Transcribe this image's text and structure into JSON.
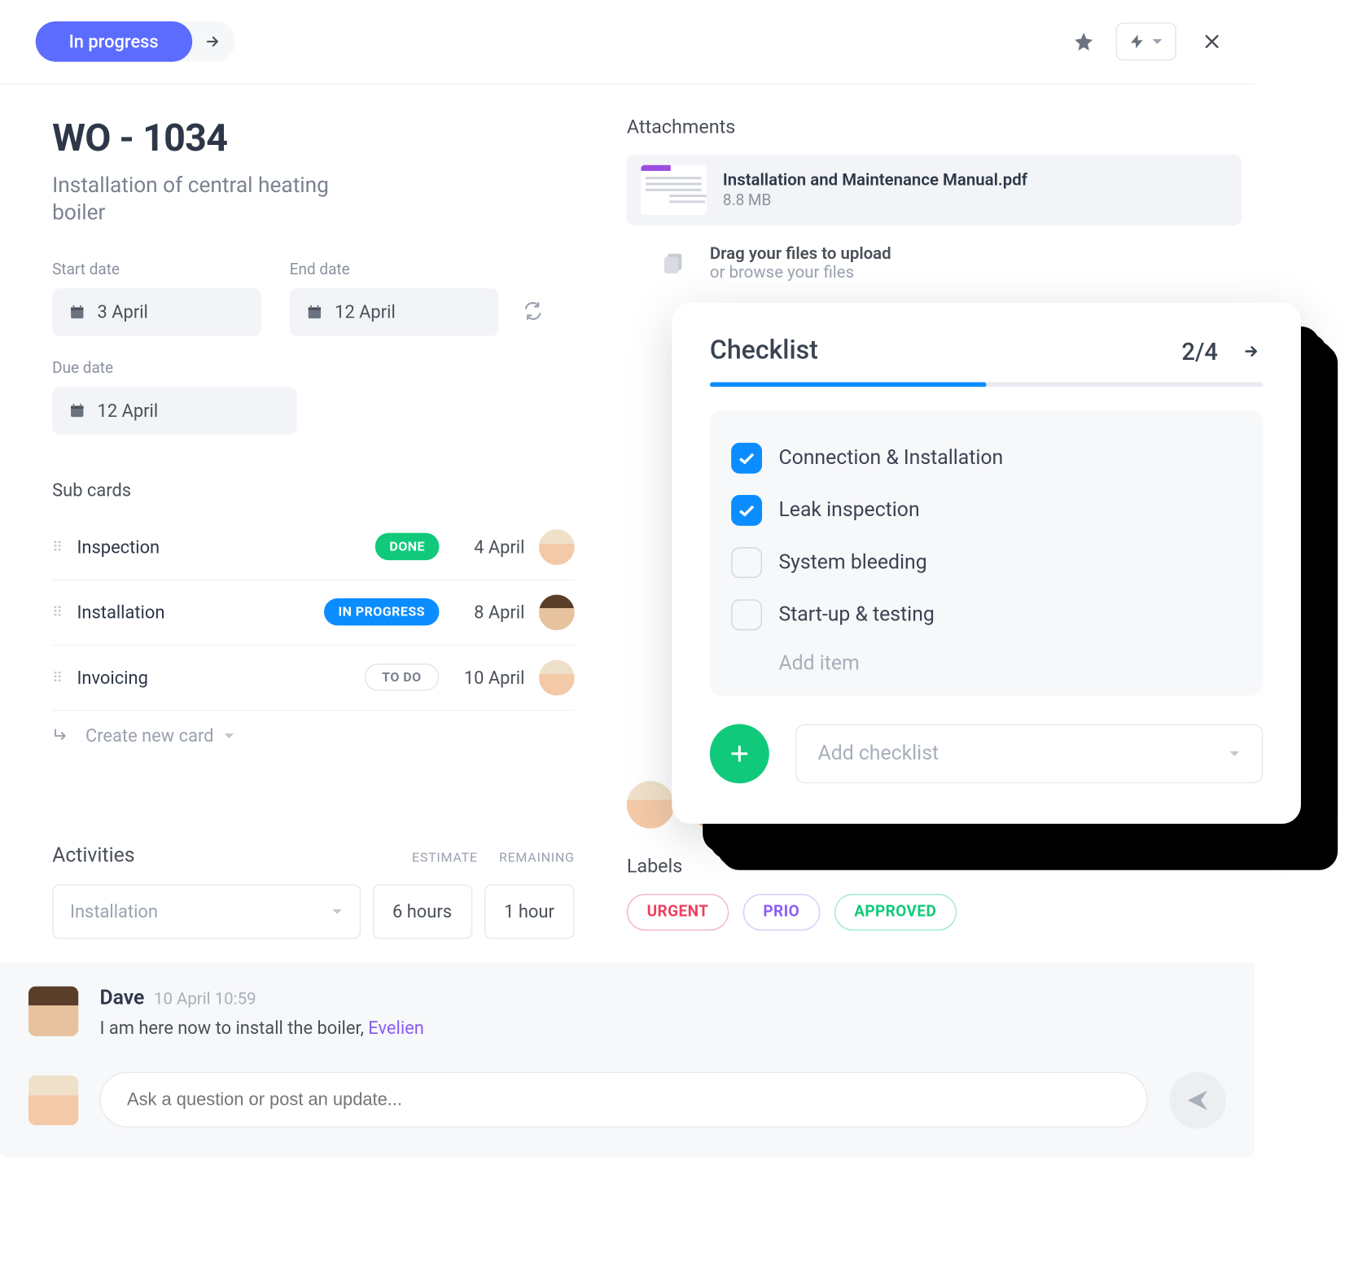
{
  "header": {
    "status": "In progress"
  },
  "workorder": {
    "title": "WO - 1034",
    "subtitle": "Installation of central heating boiler"
  },
  "dates": {
    "start_label": "Start date",
    "start_value": "3 April",
    "end_label": "End date",
    "end_value": "12 April",
    "due_label": "Due date",
    "due_value": "12 April"
  },
  "subcards": {
    "title": "Sub cards",
    "items": [
      {
        "name": "Inspection",
        "status": "DONE",
        "date": "4 April"
      },
      {
        "name": "Installation",
        "status": "IN PROGRESS",
        "date": "8 April"
      },
      {
        "name": "Invoicing",
        "status": "TO DO",
        "date": "10 April"
      }
    ],
    "create_label": "Create new card"
  },
  "activities": {
    "title": "Activities",
    "estimate_header": "ESTIMATE",
    "remaining_header": "REMAINING",
    "select_value": "Installation",
    "estimate_value": "6 hours",
    "remaining_value": "1 hour"
  },
  "attachments": {
    "title": "Attachments",
    "file_name": "Installation and Maintenance Manual.pdf",
    "file_size": "8.8 MB",
    "drop_label": "Drag your files to upload",
    "drop_sub": "or browse your files"
  },
  "checklist": {
    "title": "Checklist",
    "count": "2/4",
    "progress_pct": 50,
    "items": [
      {
        "label": "Connection & Installation",
        "checked": true
      },
      {
        "label": "Leak inspection",
        "checked": true
      },
      {
        "label": "System bleeding",
        "checked": false
      },
      {
        "label": "Start-up & testing",
        "checked": false
      }
    ],
    "add_item_placeholder": "Add item",
    "add_checklist_placeholder": "Add checklist"
  },
  "labels": {
    "title": "Labels",
    "items": [
      "URGENT",
      "PRIO",
      "APPROVED"
    ]
  },
  "comments": {
    "author": "Dave",
    "time": "10 April 10:59",
    "text_prefix": "I am here now to install the boiler, ",
    "mention": "Evelien"
  },
  "compose": {
    "placeholder": "Ask a question or post an update..."
  }
}
